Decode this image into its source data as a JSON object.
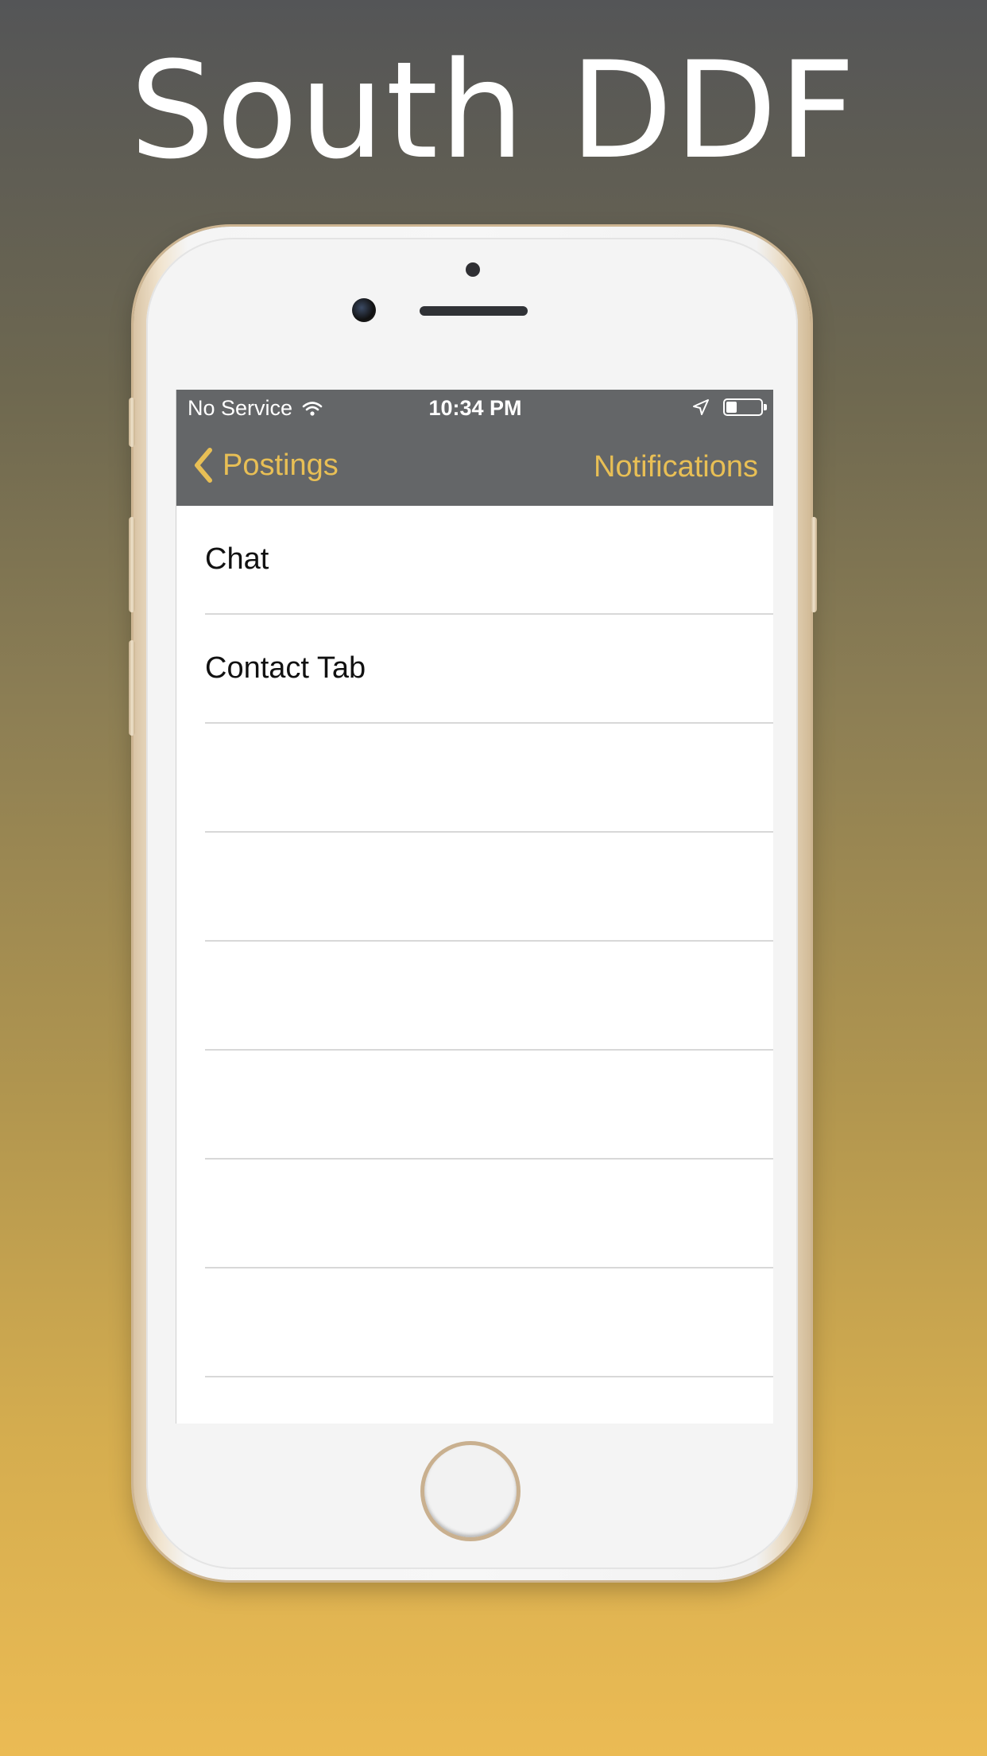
{
  "headline": "South DDF",
  "statusbar": {
    "carrier": "No Service",
    "time": "10:34 PM",
    "battery_level": 0.3
  },
  "navbar": {
    "back_label": "Postings",
    "right_label": "Notifications"
  },
  "list": {
    "items": [
      {
        "label": "Chat"
      },
      {
        "label": "Contact Tab"
      },
      {
        "label": ""
      },
      {
        "label": ""
      },
      {
        "label": ""
      },
      {
        "label": ""
      },
      {
        "label": ""
      },
      {
        "label": ""
      },
      {
        "label": ""
      }
    ]
  },
  "colors": {
    "accent": "#e8bf55",
    "navbar": "#646668",
    "background_top": "#545557",
    "background_bottom": "#ebbb54"
  }
}
